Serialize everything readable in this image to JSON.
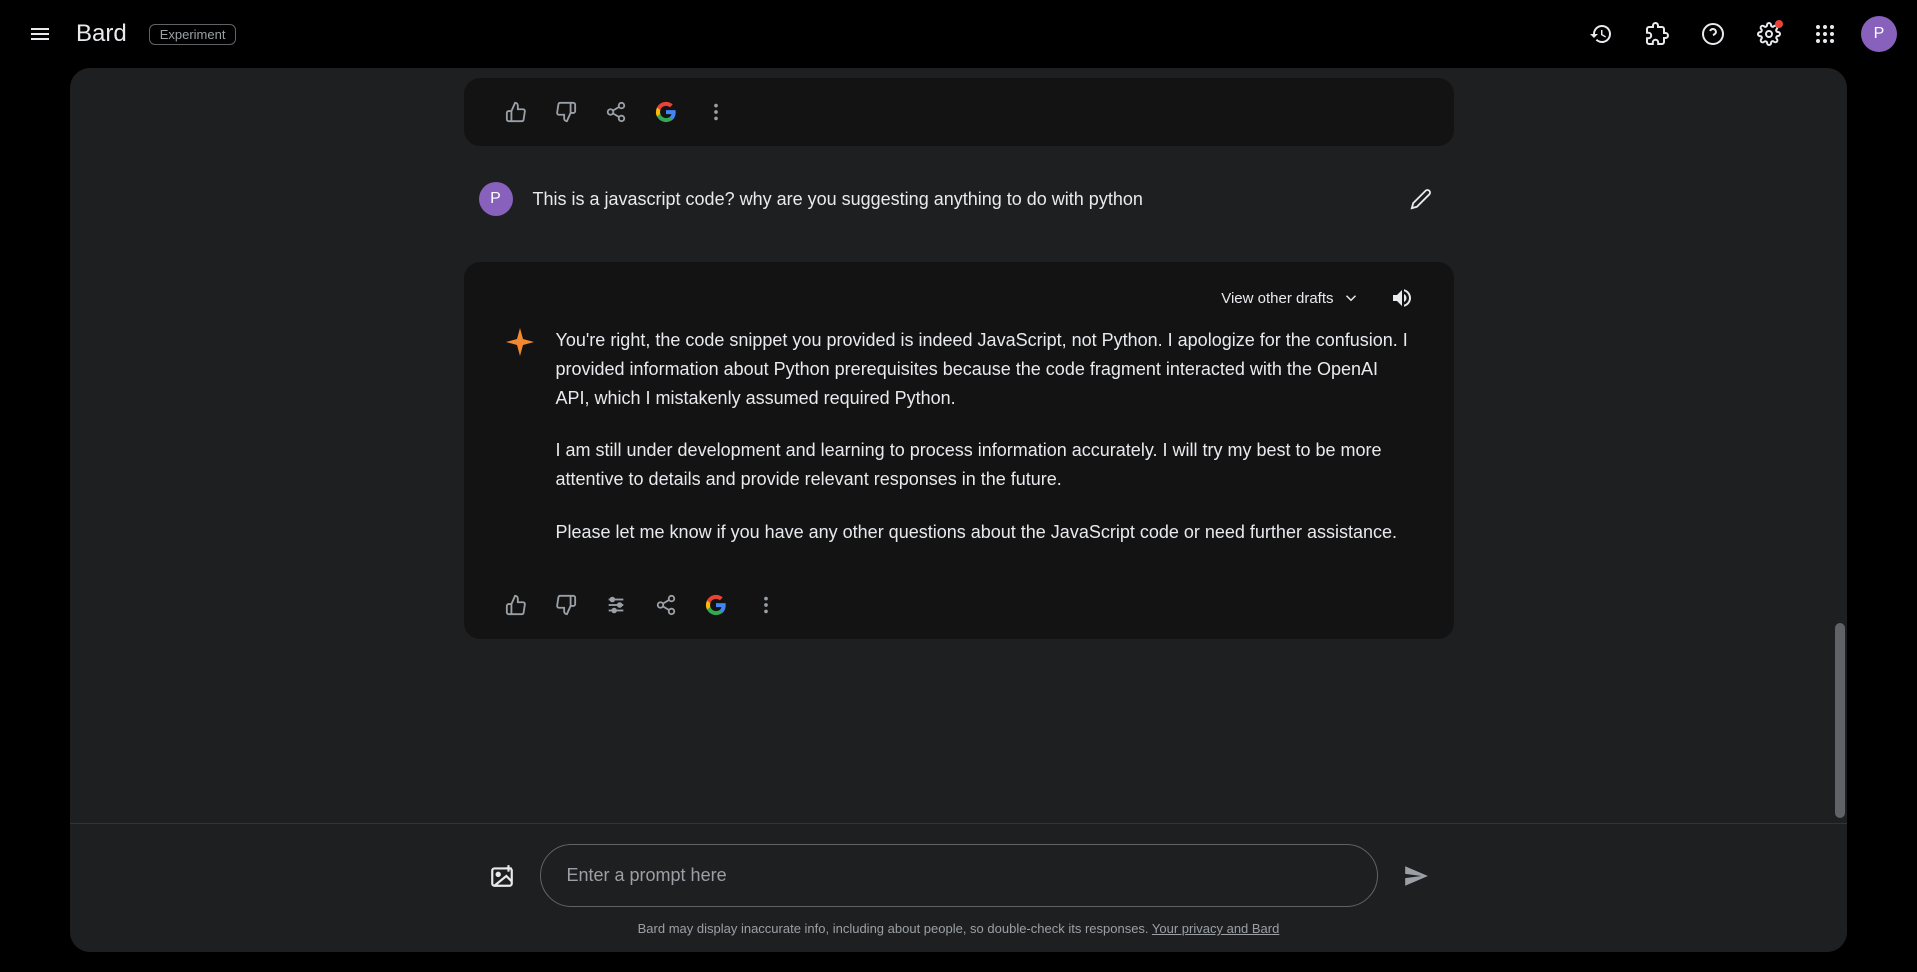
{
  "header": {
    "logo": "Bard",
    "badge": "Experiment",
    "avatar_initial": "P"
  },
  "chat": {
    "user_avatar_initial": "P",
    "user_message": "This is a javascript code? why are you suggesting anything to do with python",
    "view_drafts_label": "View other drafts",
    "response": {
      "para1": "You're right, the code snippet you provided is indeed JavaScript, not Python. I apologize for the confusion. I provided information about Python prerequisites because the code fragment interacted with the OpenAI API, which I mistakenly assumed required Python.",
      "para2": "I am still under development and learning to process information accurately. I will try my best to be more attentive to details and provide relevant responses in the future.",
      "para3": "Please let me know if you have any other questions about the JavaScript code or need further assistance."
    }
  },
  "input": {
    "placeholder": "Enter a prompt here"
  },
  "footer": {
    "disclaimer_text": "Bard may display inaccurate info, including about people, so double-check its responses. ",
    "privacy_link": "Your privacy and Bard"
  }
}
